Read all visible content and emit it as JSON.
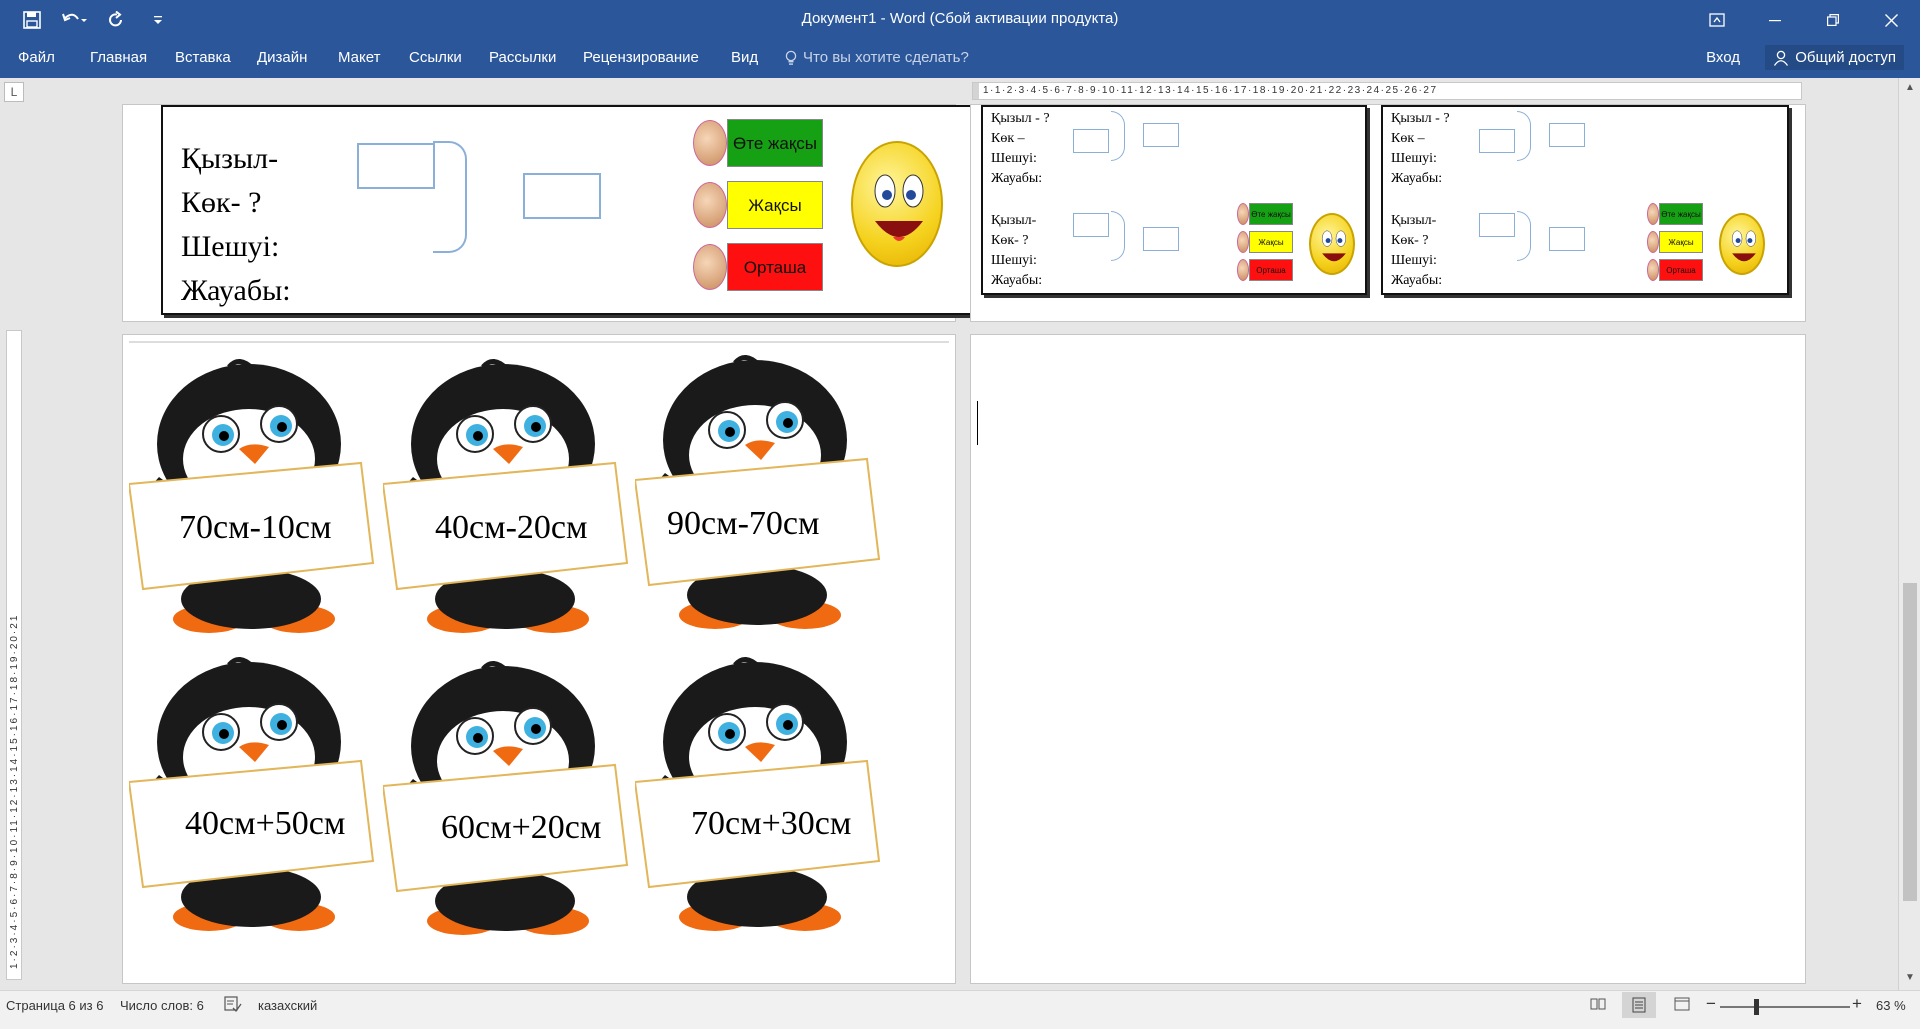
{
  "window": {
    "title": "Документ1 - Word (Сбой активации продукта)",
    "controls": [
      "ribbon-display-options",
      "minimize",
      "restore",
      "close"
    ]
  },
  "quick_access": {
    "icons": [
      "save-icon",
      "undo-icon",
      "redo-icon",
      "customize-icon"
    ]
  },
  "ribbon": {
    "tabs": [
      "Файл",
      "Главная",
      "Вставка",
      "Дизайн",
      "Макет",
      "Ссылки",
      "Рассылки",
      "Рецензирование",
      "Вид"
    ],
    "tell_me": "Что вы хотите сделать?",
    "sign_in": "Вход",
    "share": "Общий доступ"
  },
  "ruler": {
    "corner": "L",
    "horizontal": "1·1·2·3·4·5·6·7·8·9·10·11·12·13·14·15·16·17·18·19·20·21·22·23·24·25·26·27",
    "vertical": "1·2·3·4·5·6·7·8·9·10·11·12·13·14·15·16·17·18·19·20·21"
  },
  "card_large": {
    "lines": [
      "Қызыл-",
      "Көк-  ?",
      "Шешуі:",
      "Жауабы:"
    ],
    "ratings": [
      "Өте жақсы",
      "Жақсы",
      "Орташа"
    ]
  },
  "card_small_1": {
    "top_lines": [
      "Қызыл - ?",
      "Көк –",
      "Шешуі:",
      "Жауабы:"
    ],
    "bottom_lines": [
      "Қызыл-",
      "Көк-  ?",
      "Шешуі:",
      "Жауабы:"
    ],
    "ratings": [
      "Өте жақсы",
      "Жақсы",
      "Орташа"
    ]
  },
  "card_small_2": {
    "top_lines": [
      "Қызыл - ?",
      "Көк –",
      "Шешуі:",
      "Жауабы:"
    ],
    "bottom_lines": [
      "Қызыл-",
      "Көк-  ?",
      "Шешуі:",
      "Жауабы:"
    ],
    "ratings": [
      "Өте жақсы",
      "Жақсы",
      "Орташа"
    ]
  },
  "rating_colors": [
    "#16a114",
    "#ffff00",
    "#ff1010"
  ],
  "penguin_signs": [
    "70см-10см",
    "40см-20см",
    "90см-70см",
    "40см+50см",
    "60см+20см",
    "70см+30см"
  ],
  "status": {
    "page": "Страница 6 из 6",
    "words": "Число слов: 6",
    "language": "казахский",
    "zoom": "63 %"
  }
}
